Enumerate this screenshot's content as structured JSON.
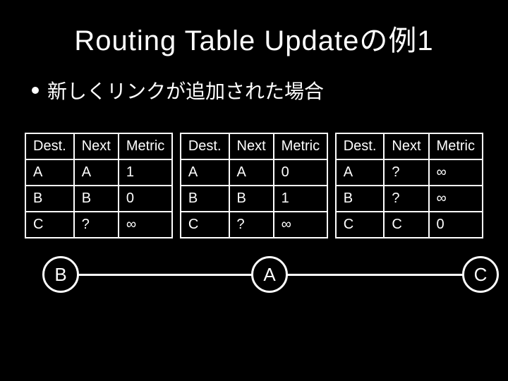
{
  "title": "Routing Table Updateの例1",
  "bullet": "新しくリンクが追加された場合",
  "headers": {
    "dest": "Dest.",
    "next": "Next",
    "metric": "Metric"
  },
  "tables": [
    {
      "rows": [
        {
          "dest": "A",
          "next": "A",
          "metric": "1"
        },
        {
          "dest": "B",
          "next": "B",
          "metric": "0"
        },
        {
          "dest": "C",
          "next": "?",
          "metric": "∞"
        }
      ]
    },
    {
      "rows": [
        {
          "dest": "A",
          "next": "A",
          "metric": "0"
        },
        {
          "dest": "B",
          "next": "B",
          "metric": "1"
        },
        {
          "dest": "C",
          "next": "?",
          "metric": "∞"
        }
      ]
    },
    {
      "rows": [
        {
          "dest": "A",
          "next": "?",
          "metric": "∞"
        },
        {
          "dest": "B",
          "next": "?",
          "metric": "∞"
        },
        {
          "dest": "C",
          "next": "C",
          "metric": "0"
        }
      ]
    }
  ],
  "nodes": {
    "left": "B",
    "center": "A",
    "right": "C"
  },
  "chart_data": {
    "type": "table",
    "title": "Routing Table Updateの例1",
    "annotation": "新しくリンクが追加された場合",
    "network": {
      "nodes": [
        "B",
        "A",
        "C"
      ],
      "edges": [
        [
          "B",
          "A"
        ],
        [
          "A",
          "C"
        ]
      ]
    },
    "routing_tables": [
      {
        "node": "B",
        "entries": [
          {
            "dest": "A",
            "next": "A",
            "metric": 1
          },
          {
            "dest": "B",
            "next": "B",
            "metric": 0
          },
          {
            "dest": "C",
            "next": "?",
            "metric": "∞"
          }
        ]
      },
      {
        "node": "A",
        "entries": [
          {
            "dest": "A",
            "next": "A",
            "metric": 0
          },
          {
            "dest": "B",
            "next": "B",
            "metric": 1
          },
          {
            "dest": "C",
            "next": "?",
            "metric": "∞"
          }
        ]
      },
      {
        "node": "C",
        "entries": [
          {
            "dest": "A",
            "next": "?",
            "metric": "∞"
          },
          {
            "dest": "B",
            "next": "?",
            "metric": "∞"
          },
          {
            "dest": "C",
            "next": "C",
            "metric": 0
          }
        ]
      }
    ]
  }
}
